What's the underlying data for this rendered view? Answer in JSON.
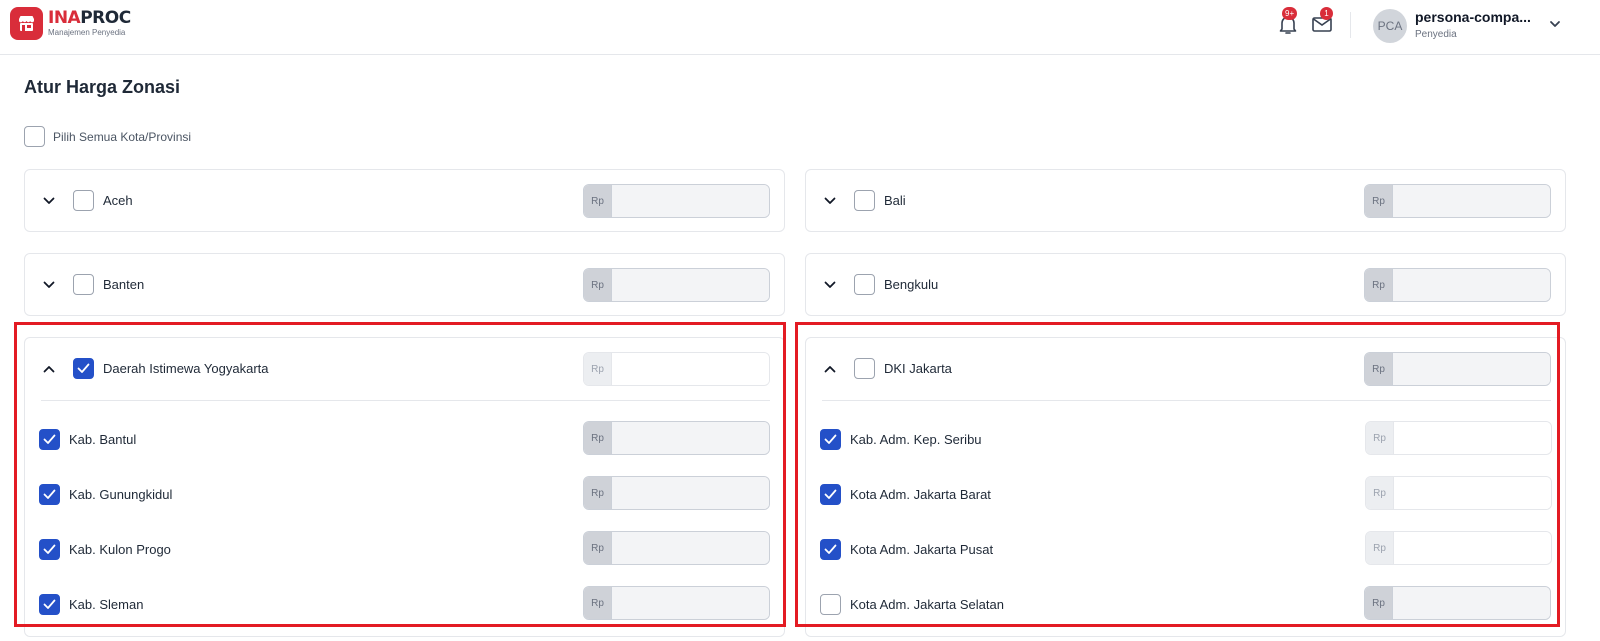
{
  "header": {
    "logo_ina": "INA",
    "logo_proc": "PROC",
    "logo_subtitle": "Manajemen Penyedia",
    "notification_count": "9+",
    "message_count": "1",
    "user": {
      "initials": "PCA",
      "name": "persona-compa...",
      "role": "Penyedia"
    }
  },
  "page": {
    "title": "Atur Harga Zonasi",
    "select_all_label": "Pilih Semua Kota/Provinsi",
    "currency_prefix": "Rp"
  },
  "provinces": {
    "aceh": "Aceh",
    "bali": "Bali",
    "banten": "Banten",
    "bengkulu": "Bengkulu",
    "diy": {
      "label": "Daerah Istimewa Yogyakarta",
      "checked": true,
      "expanded": true,
      "cities": [
        {
          "label": "Kab. Bantul",
          "checked": true
        },
        {
          "label": "Kab. Gunungkidul",
          "checked": true
        },
        {
          "label": "Kab. Kulon Progo",
          "checked": true
        },
        {
          "label": "Kab. Sleman",
          "checked": true
        }
      ]
    },
    "dki": {
      "label": "DKI Jakarta",
      "checked": false,
      "expanded": true,
      "cities": [
        {
          "label": "Kab. Adm. Kep. Seribu",
          "checked": true
        },
        {
          "label": "Kota Adm. Jakarta Barat",
          "checked": true
        },
        {
          "label": "Kota Adm. Jakarta Pusat",
          "checked": true
        },
        {
          "label": "Kota Adm. Jakarta Selatan",
          "checked": false
        }
      ]
    }
  },
  "colors": {
    "brand_red": "#d92d3a",
    "checkbox_blue": "#2450c8",
    "highlight_red": "#e31b23"
  }
}
